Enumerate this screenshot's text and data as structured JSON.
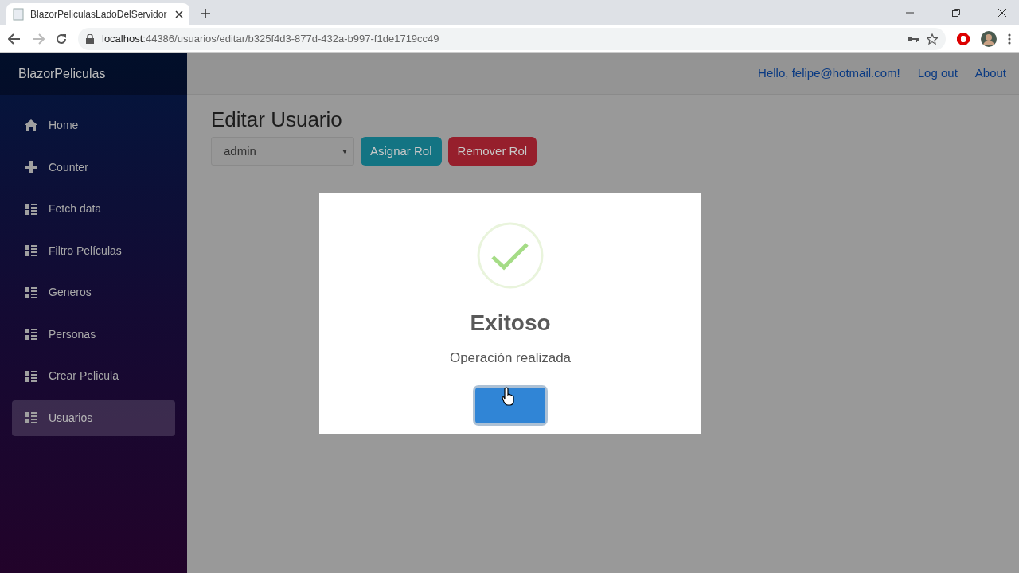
{
  "browser": {
    "tab_title": "BlazorPeliculasLadoDelServidor",
    "url_host": "localhost",
    "url_path": ":44386/usuarios/editar/b325f4d3-877d-432a-b997-f1de1719cc49"
  },
  "app": {
    "brand": "BlazorPeliculas",
    "nav": [
      {
        "label": "Home",
        "kind": "home",
        "selected": false
      },
      {
        "label": "Counter",
        "kind": "plus",
        "selected": false
      },
      {
        "label": "Fetch data",
        "kind": "list",
        "selected": false
      },
      {
        "label": "Filtro Películas",
        "kind": "list",
        "selected": false
      },
      {
        "label": "Generos",
        "kind": "list",
        "selected": false
      },
      {
        "label": "Personas",
        "kind": "list",
        "selected": false
      },
      {
        "label": "Crear Pelicula",
        "kind": "list",
        "selected": false
      },
      {
        "label": "Usuarios",
        "kind": "list",
        "selected": true
      }
    ],
    "top_links": [
      "Hello, felipe@hotmail.com!",
      "Log out",
      "About"
    ],
    "heading": "Editar Usuario",
    "role_select": {
      "value": "admin"
    },
    "buttons": [
      {
        "label": "Asignar Rol",
        "kind": "info"
      },
      {
        "label": "Remover Rol",
        "kind": "danger"
      }
    ]
  },
  "dialog": {
    "kind": "success",
    "title": "Exitoso",
    "text": "Operación realizada"
  }
}
